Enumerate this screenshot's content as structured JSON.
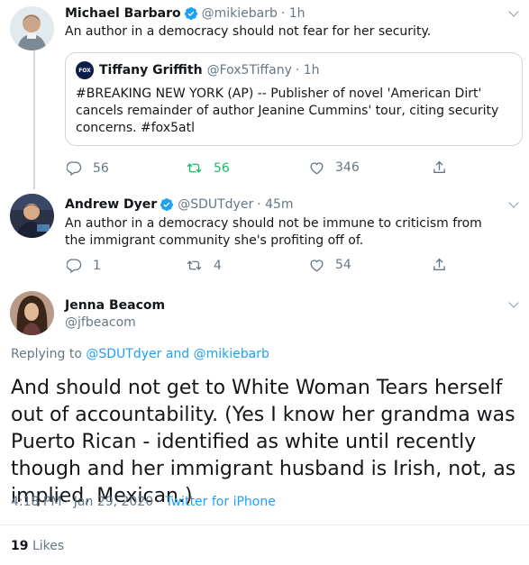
{
  "tweet1": {
    "name": "Michael Barbaro",
    "handle": "@mikiebarb",
    "time": "· 1h",
    "text": "An author in a democracy should not fear for her security.",
    "quote": {
      "name": "Tiffany Griffith",
      "handle": "@Fox5Tiffany",
      "time": "· 1h",
      "text": "#BREAKING NEW YORK (AP) -- Publisher of novel 'American Dirt' cancels remainder of author Jeanine Cummins' tour, citing security concerns. #fox5atl",
      "avatar_badge": "FOX"
    },
    "actions": {
      "replies": "56",
      "retweets": "56",
      "likes": "346"
    }
  },
  "tweet2": {
    "name": "Andrew Dyer",
    "handle": "@SDUTdyer",
    "time": "· 45m",
    "text": "An author in a democracy should not be immune to criticism from the immigrant community she's profiting off of.",
    "actions": {
      "replies": "1",
      "retweets": "4",
      "likes": "54"
    }
  },
  "main": {
    "name": "Jenna Beacom",
    "handle": "@jfbeacom",
    "replying_prefix": "Replying to",
    "replying_user1": "@SDUTdyer",
    "replying_and": "and",
    "replying_user2": "@mikiebarb",
    "text": "And should not get to White Woman Tears herself out of accountability. (Yes I know her grandma was Puerto Rican - identified as white until recently though and her immigrant husband is Irish, not, as implied, Mexican.)",
    "timestamp": "4:18 PM · Jan 29, 2020 ·",
    "source": "Twitter for iPhone",
    "likes_count": "19",
    "likes_label": "Likes"
  },
  "colors": {
    "accent": "#1da1f2",
    "retweet_green": "#17bf63",
    "muted": "#657786",
    "border": "#ccd6dd"
  },
  "icons": [
    "verified-badge-icon",
    "chevron-down-icon",
    "reply-icon",
    "retweet-icon",
    "like-icon",
    "share-icon"
  ]
}
